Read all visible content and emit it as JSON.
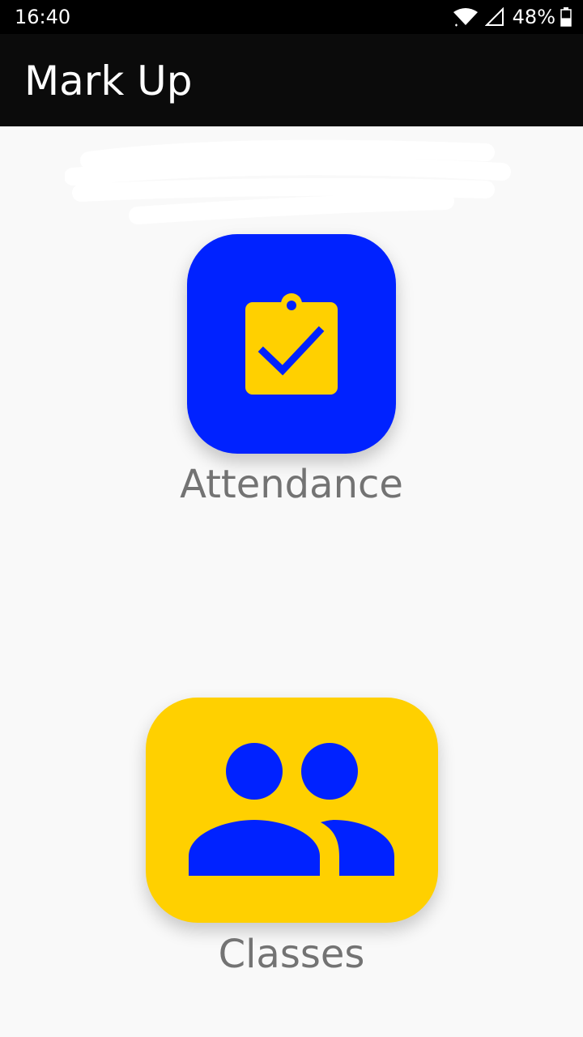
{
  "status_bar": {
    "time": "16:40",
    "battery_percent": "48%",
    "battery_level": 0.48,
    "icons": [
      "wifi-icon",
      "signal-icon",
      "battery-icon"
    ]
  },
  "app_bar": {
    "title": "Mark Up"
  },
  "menu": {
    "items": [
      {
        "label": "Attendance",
        "icon": "clipboard-check-icon",
        "color": "#0022ff"
      },
      {
        "label": "Classes",
        "icon": "people-icon",
        "color": "#ffd000"
      }
    ]
  },
  "colors": {
    "blue": "#0022ff",
    "yellow": "#ffd000",
    "label_gray": "#737373",
    "background": "#f9f9f9"
  }
}
